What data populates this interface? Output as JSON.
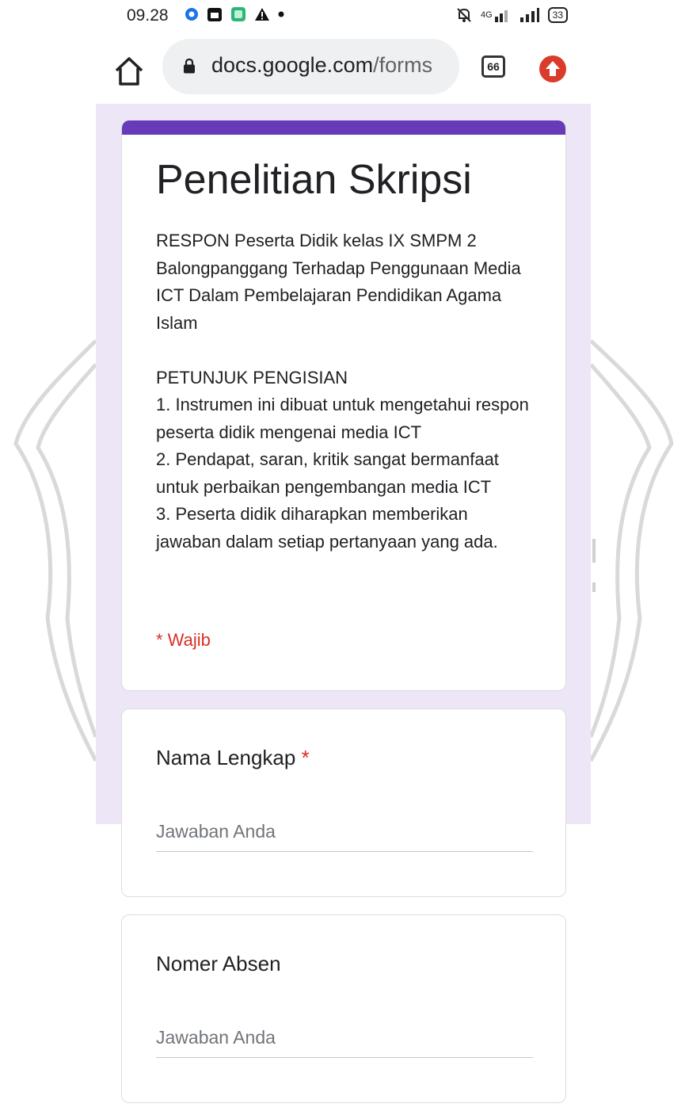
{
  "status_bar": {
    "time": "09.28",
    "network_label": "4G",
    "battery_level": "33",
    "icons": [
      "location-dot-icon",
      "calendar-icon",
      "app-square-icon",
      "warning-icon",
      "dot-icon",
      "mute-bell-icon",
      "signal-4g-icon",
      "signal-bars-icon",
      "battery-icon"
    ]
  },
  "browser": {
    "url_main": "docs.google.com",
    "url_path": "/forms",
    "tab_count": "66",
    "icons": [
      "home-icon",
      "lock-icon",
      "tabs-icon",
      "update-arrow-icon"
    ]
  },
  "form": {
    "title": "Penelitian Skripsi",
    "description": "RESPON Peserta Didik kelas IX SMPM 2 Balongpanggang Terhadap Penggunaan Media ICT Dalam Pembelajaran Pendidikan Agama Islam\n\nPETUNJUK PENGISIAN\n1. Instrumen ini dibuat untuk mengetahui respon peserta didik mengenai media ICT\n2. Pendapat, saran, kritik sangat bermanfaat untuk perbaikan pengembangan media ICT\n3. Peserta didik diharapkan memberikan jawaban dalam setiap pertanyaan yang ada.",
    "required_note": "* Wajib",
    "questions": [
      {
        "label": "Nama Lengkap",
        "required_mark": "*",
        "placeholder": "Jawaban Anda",
        "value": ""
      },
      {
        "label": "Nomer Absen",
        "required_mark": "",
        "placeholder": "Jawaban Anda",
        "value": ""
      }
    ]
  },
  "colors": {
    "accent": "#673ab7",
    "form_background": "#ece6f6",
    "required": "#d93025",
    "update_button": "#db3b2b"
  }
}
